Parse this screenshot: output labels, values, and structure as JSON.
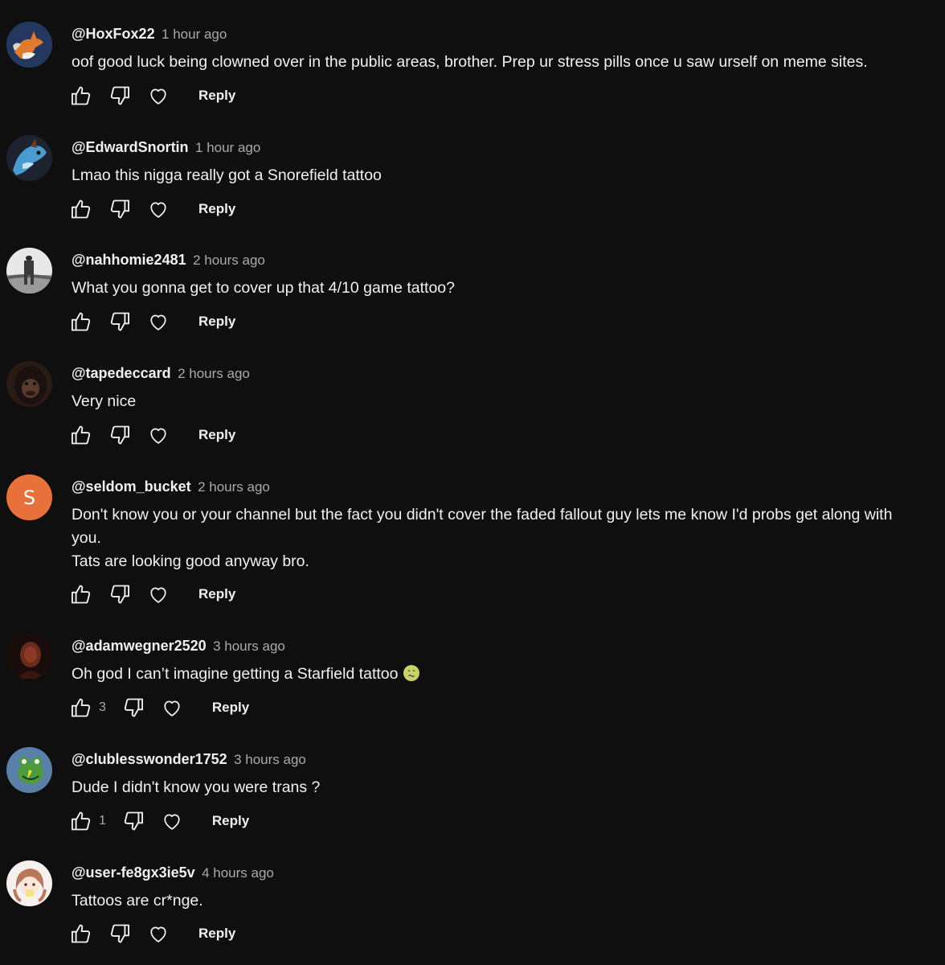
{
  "toolbar": {
    "reply_label": "Reply"
  },
  "comments": [
    {
      "author": "@HoxFox22",
      "time": "1 hour ago",
      "lines": [
        "oof good luck being clowned over in the public areas, brother. Prep ur stress pills once u saw urself on meme sites."
      ],
      "likes": "",
      "avatar": "fox-avatar"
    },
    {
      "author": "@EdwardSnortin",
      "time": "1 hour ago",
      "lines": [
        "Lmao this nigga really got a Snorefield tattoo"
      ],
      "likes": "",
      "avatar": "blue-creature-avatar"
    },
    {
      "author": "@nahhomie2481",
      "time": "2 hours ago",
      "lines": [
        "What you gonna get to cover up that 4/10 game tattoo?"
      ],
      "likes": "",
      "avatar": "bw-photo-avatar"
    },
    {
      "author": "@tapedeccard",
      "time": "2 hours ago",
      "lines": [
        "Very nice"
      ],
      "likes": "",
      "avatar": "gorilla-avatar"
    },
    {
      "author": "@seldom_bucket",
      "time": "2 hours ago",
      "lines": [
        "Don't know you or your channel but the fact you didn't cover the faded fallout guy lets me know I'd probs get along with",
        "you.",
        "Tats are looking good anyway bro."
      ],
      "likes": "",
      "avatar_letter": "S"
    },
    {
      "author": "@adamwegner2520",
      "time": "3 hours ago",
      "lines": [
        "Oh god I can’t imagine getting a Starfield tattoo"
      ],
      "likes": "3",
      "avatar": "dark-red-avatar",
      "emoji": "nauseated-face-emoji"
    },
    {
      "author": "@clublesswonder1752",
      "time": "3 hours ago",
      "lines": [
        "Dude I didn't know you were trans ?"
      ],
      "likes": "1",
      "avatar": "frog-avatar"
    },
    {
      "author": "@user-fe8gx3ie5v",
      "time": "4 hours ago",
      "lines": [
        "Tattoos are cr*nge."
      ],
      "likes": "",
      "avatar": "anime-girl-avatar"
    }
  ]
}
